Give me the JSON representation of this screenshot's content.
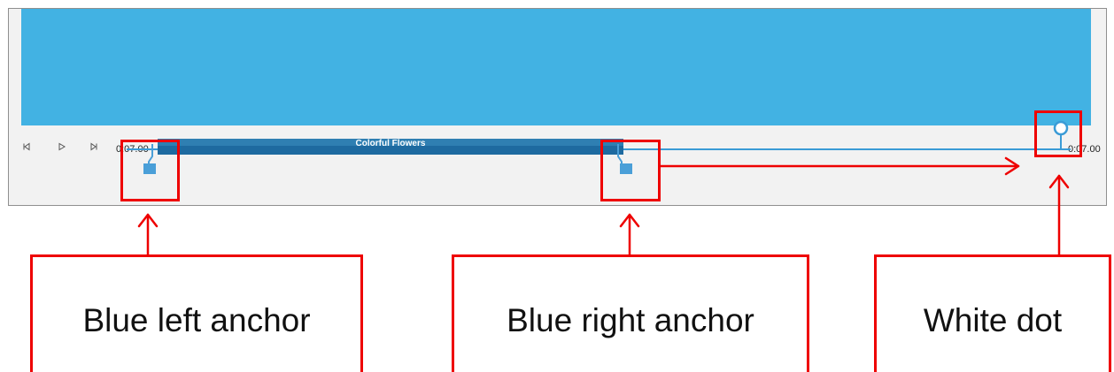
{
  "colors": {
    "preview": "#42b2e3",
    "clip_top": "#2f7fb2",
    "clip_bottom": "#1e6aa0",
    "track": "#3a9bd6",
    "anchor": "#4a9fd8",
    "annotation": "#ee0000"
  },
  "controls": {
    "prev_icon": "step-back-icon",
    "play_icon": "play-icon",
    "next_icon": "step-forward-icon"
  },
  "timeline": {
    "start_time": "0:07.00",
    "end_time": "0:07.00",
    "clip_title": "Colorful Flowers"
  },
  "annotations": {
    "left_anchor_label": "Blue left anchor",
    "right_anchor_label": "Blue right anchor",
    "white_dot_label": "White dot"
  }
}
